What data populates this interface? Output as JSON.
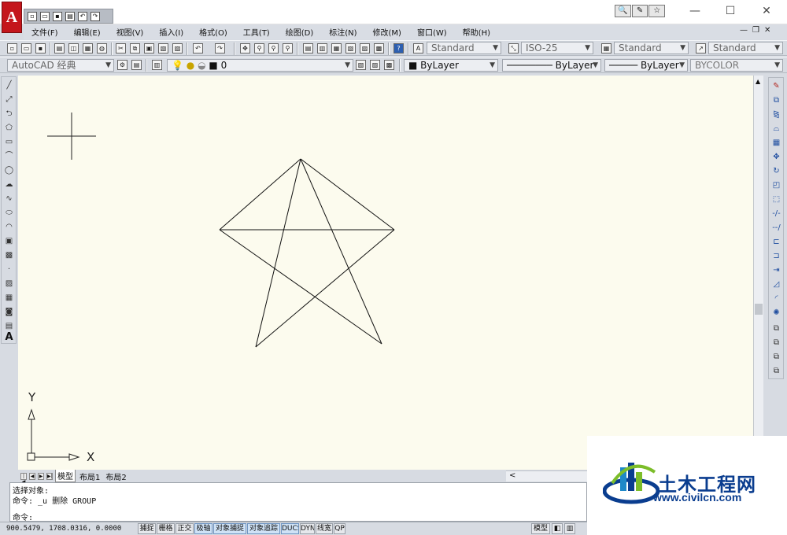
{
  "app": {
    "logo_letter": "A"
  },
  "title_controls": {
    "minimize": "—",
    "maximize": "☐",
    "close": "✕"
  },
  "info_buttons": [
    "🔍",
    "✎",
    "☆"
  ],
  "menu": [
    "文件(F)",
    "编辑(E)",
    "视图(V)",
    "插入(I)",
    "格式(O)",
    "工具(T)",
    "绘图(D)",
    "标注(N)",
    "修改(M)",
    "窗口(W)",
    "帮助(H)"
  ],
  "mdi_controls": [
    "—",
    "❐",
    "✕"
  ],
  "styles_toolbar": {
    "text_style": "Standard",
    "dim_style": "ISO-25",
    "table_style": "Standard",
    "multileader_style": "Standard"
  },
  "workspace": "AutoCAD 经典",
  "layer": {
    "current": "0"
  },
  "properties": {
    "color": "ByLayer",
    "linetype": "ByLayer",
    "lineweight": "ByLayer",
    "plotstyle": "BYCOLOR"
  },
  "ucs": {
    "x_label": "X",
    "y_label": "Y"
  },
  "layout_tabs": [
    {
      "label": "模型",
      "active": true
    },
    {
      "label": "布局1",
      "active": false
    },
    {
      "label": "布局2",
      "active": false
    }
  ],
  "command_lines": [
    "选择对象:",
    "命令: _u 删除 GROUP",
    "命令:"
  ],
  "status": {
    "coordinates": "900.5479,    1708.0316, 0.0000",
    "toggles": [
      {
        "label": "捕捉",
        "on": false
      },
      {
        "label": "栅格",
        "on": false
      },
      {
        "label": "正交",
        "on": false
      },
      {
        "label": "极轴",
        "on": true
      },
      {
        "label": "对象捕捉",
        "on": true
      },
      {
        "label": "对象追踪",
        "on": true
      },
      {
        "label": "DUCS",
        "on": true
      },
      {
        "label": "DYN",
        "on": false
      },
      {
        "label": "线宽",
        "on": false
      },
      {
        "label": "QP",
        "on": false
      }
    ],
    "model_label": "模型"
  },
  "watermark": {
    "brand": "土木工程网",
    "url": "www.civilcn.com"
  },
  "colors": {
    "canvas": "#fcfbee",
    "chrome": "#d7dbe2",
    "logo_red": "#c4161c",
    "toggle_on": "#cfe2f6",
    "brand_blue": "#0a3d8f"
  }
}
